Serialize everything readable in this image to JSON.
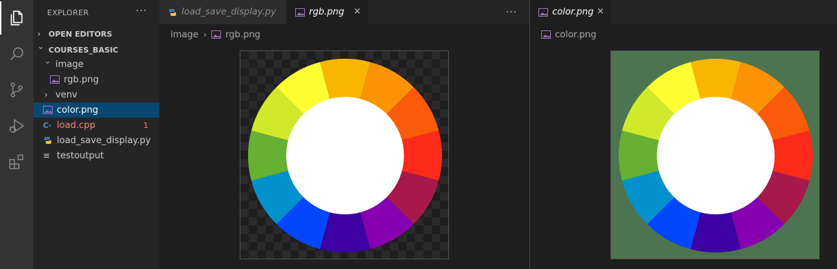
{
  "activity_bar": {
    "items": [
      {
        "icon": "files-icon",
        "active": true
      },
      {
        "icon": "search-icon",
        "active": false
      },
      {
        "icon": "source-control-icon",
        "active": false
      },
      {
        "icon": "run-debug-icon",
        "active": false
      },
      {
        "icon": "extensions-icon",
        "active": false
      }
    ]
  },
  "sidebar": {
    "title": "EXPLORER",
    "more": "···",
    "open_editors_label": "OPEN EDITORS",
    "project_label": "COURSES_BASIC",
    "tree": {
      "image_folder": "image",
      "rgb_file": "rgb.png",
      "venv_folder": "venv",
      "color_file": "color.png",
      "load_cpp": "load.cpp",
      "load_cpp_problems": "1",
      "load_save_py": "load_save_display.py",
      "testoutput": "testoutput"
    }
  },
  "editor_left": {
    "tabs": [
      {
        "label": "load_save_display.py",
        "active": false
      },
      {
        "label": "rgb.png",
        "active": true,
        "close": "×"
      }
    ],
    "more": "···",
    "breadcrumb": {
      "folder": "image",
      "separator": "›",
      "file": "rgb.png"
    },
    "image": {
      "background": "transparent-checkerboard"
    }
  },
  "editor_right": {
    "tabs": [
      {
        "label": "color.png",
        "active": true,
        "close": "×"
      }
    ],
    "breadcrumb": {
      "file": "color.png"
    },
    "image": {
      "background": "#4c7450"
    }
  },
  "color_wheel": {
    "segment_colors": [
      "#f9b601",
      "#fb9304",
      "#fa5a0a",
      "#fb2a1a",
      "#a7194b",
      "#8601af",
      "#3d01a4",
      "#0247fe",
      "#0391ce",
      "#66b032",
      "#d0ea2b",
      "#fefe33"
    ],
    "center_color": "#ffffff"
  },
  "colors": {
    "activity_bar": "#333333",
    "sidebar": "#252526",
    "editor": "#1e1e1e",
    "selection": "#094771",
    "error_text": "#f48771"
  }
}
